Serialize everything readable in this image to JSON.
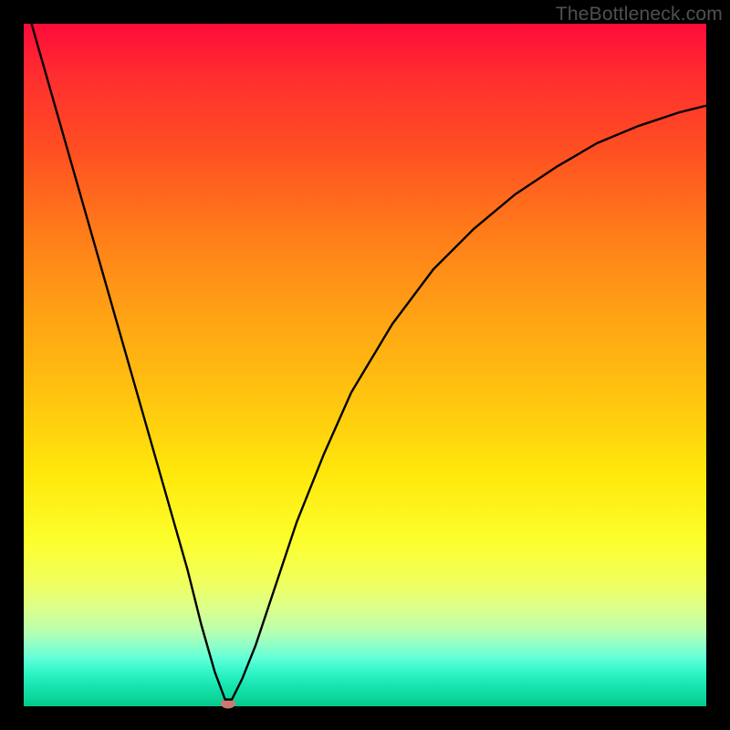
{
  "watermark": "TheBottleneck.com",
  "chart_data": {
    "type": "line",
    "title": "",
    "xlabel": "",
    "ylabel": "",
    "xlim": [
      0,
      100
    ],
    "ylim": [
      0,
      100
    ],
    "grid": false,
    "background_gradient_stops": [
      {
        "pos": 0,
        "color": "#ff0b3a"
      },
      {
        "pos": 8,
        "color": "#ff2f2f"
      },
      {
        "pos": 18,
        "color": "#ff4d22"
      },
      {
        "pos": 30,
        "color": "#ff7a1a"
      },
      {
        "pos": 42,
        "color": "#ffa015"
      },
      {
        "pos": 54,
        "color": "#ffc210"
      },
      {
        "pos": 66,
        "color": "#ffe80c"
      },
      {
        "pos": 76,
        "color": "#fcff2e"
      },
      {
        "pos": 82,
        "color": "#f0ff60"
      },
      {
        "pos": 86,
        "color": "#d8ff8e"
      },
      {
        "pos": 89,
        "color": "#b8ffb0"
      },
      {
        "pos": 91,
        "color": "#90ffc8"
      },
      {
        "pos": 93,
        "color": "#60ffd8"
      },
      {
        "pos": 95,
        "color": "#30f5c8"
      },
      {
        "pos": 97,
        "color": "#18e4b0"
      },
      {
        "pos": 99,
        "color": "#0cd498"
      },
      {
        "pos": 100,
        "color": "#00c888"
      }
    ],
    "series": [
      {
        "name": "bottleneck-curve",
        "x": [
          0,
          4,
          8,
          12,
          16,
          20,
          24,
          26,
          28,
          29.5,
          30.5,
          32,
          34,
          36,
          40,
          44,
          48,
          54,
          60,
          66,
          72,
          78,
          84,
          90,
          96,
          100
        ],
        "y": [
          104,
          90,
          76,
          62,
          48,
          34,
          20,
          12,
          5,
          1,
          1,
          4,
          9,
          15,
          27,
          37,
          46,
          56,
          64,
          70,
          75,
          79,
          82.5,
          85,
          87,
          88
        ],
        "minimum": {
          "x": 30,
          "y": 0
        }
      }
    ],
    "marker": {
      "x_pct": 30,
      "y_pct": 0,
      "color": "#c97a70"
    }
  }
}
